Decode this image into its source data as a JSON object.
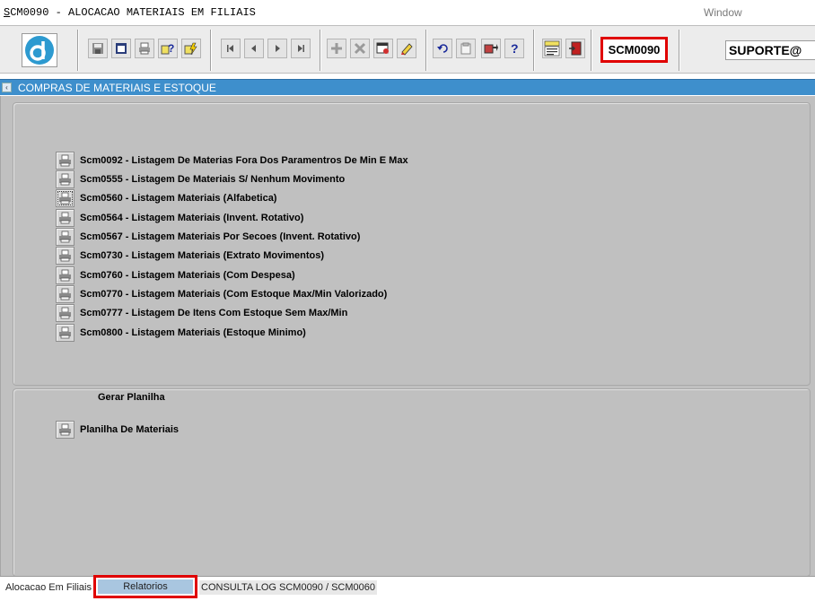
{
  "window": {
    "title_prefix": "S",
    "title_rest": "CM0090 - ALOCACAO MATERIAIS EM FILIAIS",
    "menu": "Window"
  },
  "toolbar": {
    "screen_code": "SCM0090",
    "user": "SUPORTE@",
    "buttons": [
      "save-icon",
      "window-icon",
      "print-icon",
      "help-query-icon",
      "run-query-icon",
      "first-record-icon",
      "previous-record-icon",
      "next-record-icon",
      "last-record-icon",
      "add-record-icon",
      "delete-record-icon",
      "edit-record-icon",
      "clear-record-icon",
      "undo-icon",
      "copy-icon",
      "tools-icon",
      "help-icon",
      "menu-icon",
      "exit-icon"
    ]
  },
  "module": {
    "title": "COMPRAS DE MATERIAIS E ESTOQUE"
  },
  "reports": [
    "Scm0092 - Listagem De Materias Fora Dos Paramentros De Min E Max",
    "Scm0555 - Listagem De Materiais S/ Nenhum Movimento",
    "Scm0560 - Listagem Materiais (Alfabetica)",
    "Scm0564 - Listagem Materiais (Invent. Rotativo)",
    "Scm0567 - Listagem Materiais Por Secoes (Invent. Rotativo)",
    "Scm0730 - Listagem Materiais (Extrato Movimentos)",
    "Scm0760 - Listagem Materiais (Com Despesa)",
    "Scm0770 - Listagem Materiais (Com Estoque Max/Min Valorizado)",
    "Scm0777 - Listagem De Itens Com Estoque Sem Max/Min",
    "Scm0800 - Listagem Materiais (Estoque Minimo)"
  ],
  "spreadsheet": {
    "title": "Gerar Planilha",
    "item": "Planilha De Materiais"
  },
  "tabs": [
    "Alocacao Em Filiais",
    "Relatorios",
    "CONSULTA LOG SCM0090 / SCM0060"
  ],
  "colors": {
    "module_header": "#3e8fcc",
    "highlight_border": "#e00000",
    "panel_bg": "#c0c0c0",
    "active_tab": "#a9c6e0"
  }
}
